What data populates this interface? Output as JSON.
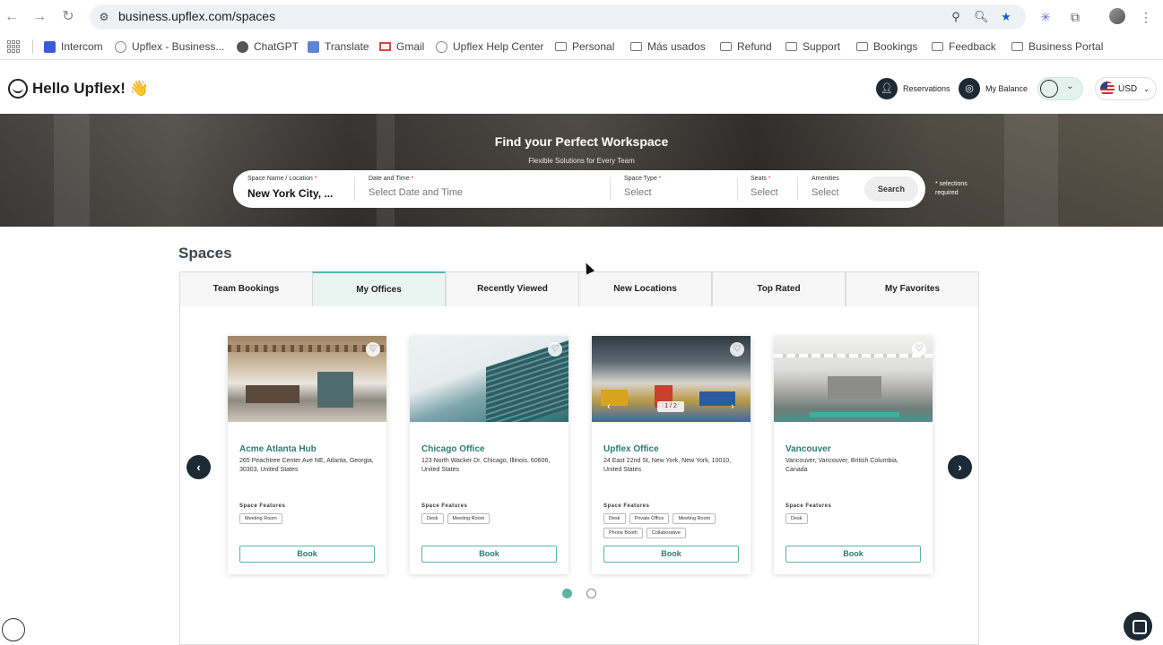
{
  "browser": {
    "url": "business.upflex.com/spaces",
    "bookmarks": [
      "Intercom",
      "Upflex - Business...",
      "ChatGPT",
      "Translate",
      "Gmail",
      "Upflex Help Center",
      "Personal",
      "Más usados",
      "Refund",
      "Support",
      "Bookings",
      "Feedback",
      "Business Portal"
    ]
  },
  "header": {
    "greeting": "Hello Upflex! 👋",
    "reservations": "Reservations",
    "balance": "My Balance",
    "currency": "USD"
  },
  "hero": {
    "title": "Find your Perfect Workspace",
    "subtitle": "Flexible Solutions for Every Team",
    "fields": {
      "location_label": "Space Name / Location",
      "location_value": "New York City, ...",
      "date_label": "Date and Time",
      "date_placeholder": "Select Date and Time",
      "type_label": "Space Type",
      "type_placeholder": "Select",
      "seats_label": "Seats",
      "seats_placeholder": "Select",
      "amenities_label": "Amenities",
      "amenities_placeholder": "Select"
    },
    "search_button": "Search",
    "required_note": "* selections required"
  },
  "spaces": {
    "title": "Spaces",
    "tabs": [
      "Team Bookings",
      "My Offices",
      "Recently Viewed",
      "New Locations",
      "Top Rated",
      "My Favorites"
    ],
    "active_tab": "My Offices",
    "features_label": "Space Features",
    "book_label": "Book",
    "cards": [
      {
        "name": "Acme Atlanta Hub",
        "address": "265 Peachtree Center Ave NE, Atlanta, Georgia, 30303, United States",
        "features": [
          "Meeting Room"
        ]
      },
      {
        "name": "Chicago Office",
        "address": "123 North Wacker Dr, Chicago, Illinois, 60606, United States",
        "features": [
          "Desk",
          "Meeting Room"
        ]
      },
      {
        "name": "Upflex Office",
        "address": "24 East 22nd St, New York, New York, 10010, United States",
        "features": [
          "Desk",
          "Private Office",
          "Meeting Room",
          "Phone Booth",
          "Collaborative"
        ],
        "image_counter": "1 / 2"
      },
      {
        "name": "Vancouver",
        "address": "Vancouver, Vancouver, British Columbia, Canada",
        "features": [
          "Desk"
        ]
      }
    ],
    "pagination": {
      "current": 1,
      "total": 2
    }
  },
  "colors": {
    "accent": "#5ab4a8",
    "dark": "#1a2b35",
    "link": "#2a7d6f"
  }
}
